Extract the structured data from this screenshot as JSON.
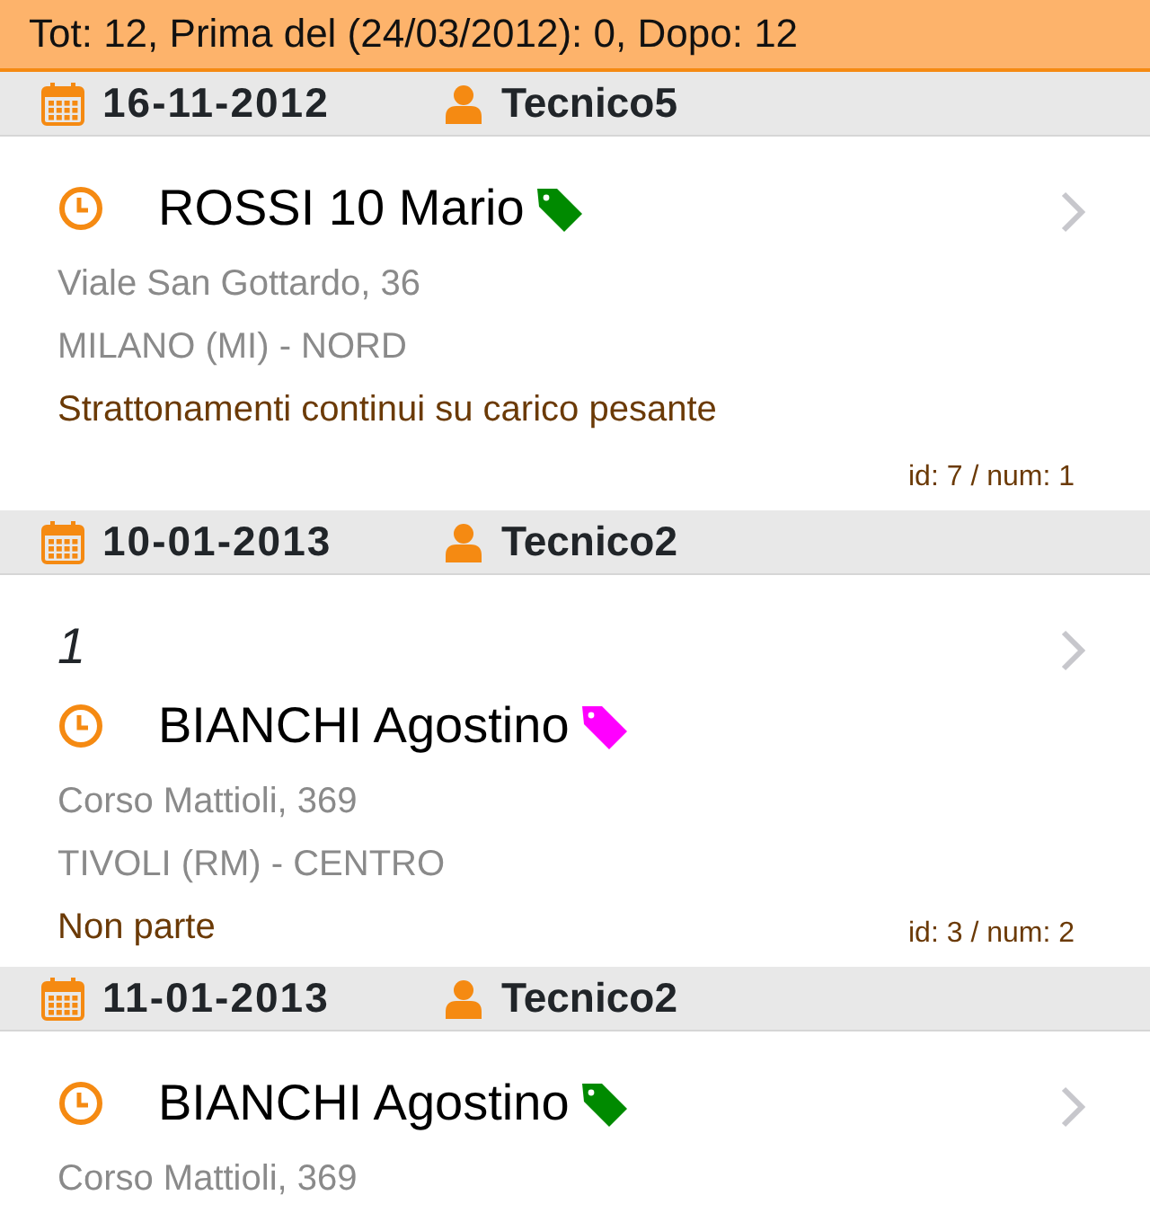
{
  "summary": "Tot: 12, Prima del (24/03/2012): 0, Dopo: 12",
  "groups": [
    {
      "date": "16-11-2012",
      "technician": "Tecnico5",
      "item": {
        "name": "ROSSI 10 Mario",
        "color": "#008a00",
        "address": "Viale San Gottardo, 36",
        "city": "MILANO (MI) - NORD",
        "description": "Strattonamenti continui su carico pesante",
        "id_label": "id: 7 / num: 1"
      }
    },
    {
      "date": "10-01-2013",
      "technician": "Tecnico2",
      "item": {
        "note": "1",
        "name": "BIANCHI Agostino",
        "color": "#ff00ff",
        "address": "Corso Mattioli, 369",
        "city": "TIVOLI (RM) - CENTRO",
        "description": "Non parte",
        "id_label": "id: 3 / num: 2"
      }
    },
    {
      "date": "11-01-2013",
      "technician": "Tecnico2",
      "item": {
        "name": "BIANCHI Agostino",
        "color": "#008a00",
        "address": "Corso Mattioli, 369"
      }
    }
  ]
}
